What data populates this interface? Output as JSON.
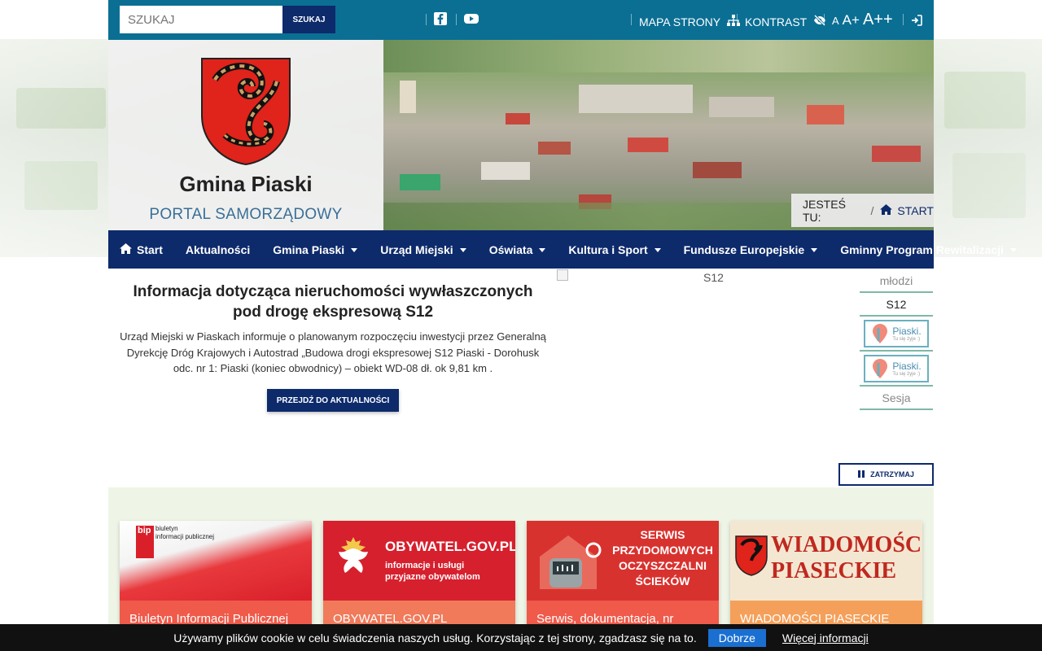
{
  "topbar": {
    "search_placeholder": "SZUKAJ",
    "search_button": "SZUKAJ",
    "sitemap": "MAPA STRONY",
    "contrast": "KONTRAST",
    "font_small": "A",
    "font_medium": "A+",
    "font_large": "A++"
  },
  "header": {
    "title": "Gmina Piaski",
    "subtitle": "PORTAL SAMORZĄDOWY",
    "breadcrumb_label": "JESTEŚ TU:",
    "breadcrumb_sep": "/",
    "breadcrumb_current": "START"
  },
  "nav": {
    "items": [
      {
        "label": "Start",
        "dropdown": false
      },
      {
        "label": "Aktualności",
        "dropdown": false
      },
      {
        "label": "Gmina Piaski",
        "dropdown": true
      },
      {
        "label": "Urząd Miejski",
        "dropdown": true
      },
      {
        "label": "Oświata",
        "dropdown": true
      },
      {
        "label": "Kultura i Sport",
        "dropdown": true
      },
      {
        "label": "Fundusze Europejskie",
        "dropdown": true
      },
      {
        "label": "Gminny Program Rewitalizacji",
        "dropdown": true
      }
    ]
  },
  "news": {
    "title": "Informacja dotycząca nieruchomości wywłaszczonych pod drogę ekspresową S12",
    "body": "Urząd Miejski w Piaskach informuje o planowanym rozpoczęciu inwestycji przez Generalną Dyrekcję Dróg Krajowych i Autostrad „Budowa drogi ekspresowej S12 Piaski - Dorohusk odc. nr 1: Piaski (koniec obwodnicy) – obiekt WD-08 dł. ok 9,81 km .",
    "button": "PRZEJDŹ DO AKTUALNOŚCI",
    "image_alt": "S12"
  },
  "thumbs": [
    {
      "alt": "młodzi"
    },
    {
      "alt": "S12"
    },
    {
      "alt": "Piaski logo",
      "logo_text": "Piaski.",
      "logo_sub": "Tu się żyje :)"
    },
    {
      "alt": "Piaski logo",
      "logo_text": "Piaski.",
      "logo_sub": "Tu się żyje :)"
    },
    {
      "alt": "Sesja"
    }
  ],
  "pause_button": "ZATRZYMAJ",
  "cards": [
    {
      "caption": "Biuletyn Informacji Publicznej",
      "banner_line1": "biuletyn",
      "banner_line2": "informacji publicznej",
      "bip": "bip"
    },
    {
      "caption": "OBYWATEL.GOV.PL",
      "banner_title": "OBYWATEL.GOV.PL",
      "banner_sub1": "informacje i usługi",
      "banner_sub2": "przyjazne obywatelom"
    },
    {
      "caption": "Serwis, dokumentacja, nr",
      "banner_title1": "SERWIS",
      "banner_title2": "PRZYDOMOWYCH",
      "banner_title3": "OCZYSZCZALNI",
      "banner_title4": "ŚCIEKÓW"
    },
    {
      "caption": "WIADOMOŚCI PIASECKIE",
      "banner_title1": "WIADOMOŚCI",
      "banner_title2": "PIASECKIE"
    }
  ],
  "cookie": {
    "text": "Używamy plików cookie w celu świadczenia naszych usług. Korzystając z tej strony, zgadzasz się na to.",
    "accept": "Dobrze",
    "more": "Więcej informacji"
  },
  "colors": {
    "topbar": "#0b6f94",
    "nav": "#0d2a6b",
    "accent_card": "#ef5a4a"
  }
}
